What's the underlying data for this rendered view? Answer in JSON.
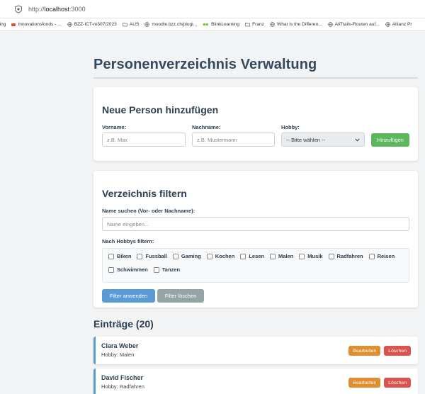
{
  "browser": {
    "url_prefix": "http://",
    "url_host": "localhost",
    "url_port": ":3000",
    "bookmarks": [
      {
        "label": "ning",
        "icon": "none-icon"
      },
      {
        "label": "Innovationsfonds - ...",
        "icon": "bookmark-icon"
      },
      {
        "label": "BZZ-ICT-m307/2023",
        "icon": "globe-icon"
      },
      {
        "label": "AUS",
        "icon": "folder-icon"
      },
      {
        "label": "moodle.bzz.ch/plugi...",
        "icon": "globe-icon"
      },
      {
        "label": "BlinkLearning",
        "icon": "dots-icon"
      },
      {
        "label": "Franz",
        "icon": "folder-icon"
      },
      {
        "label": "What Is the Differen...",
        "icon": "globe-icon"
      },
      {
        "label": "AllTrails-Routen auf...",
        "icon": "globe-icon"
      },
      {
        "label": "Allianz Pr",
        "icon": "globe-icon"
      }
    ]
  },
  "page": {
    "title": "Personenverzeichnis Verwaltung"
  },
  "add_form": {
    "title": "Neue Person hinzufügen",
    "firstname_label": "Vorname:",
    "firstname_placeholder": "z.B. Max",
    "lastname_label": "Nachname:",
    "lastname_placeholder": "z.B. Mustermann",
    "hobby_label": "Hobby:",
    "hobby_selected": "-- Bitte wählen --",
    "submit_label": "Hinzufügen"
  },
  "filter": {
    "title": "Verzeichnis filtern",
    "name_label": "Name suchen (Vor- oder Nachname):",
    "name_placeholder": "Name eingeben...",
    "hobby_label": "Nach Hobbys filtern:",
    "hobbies": [
      "Biken",
      "Fussball",
      "Gaming",
      "Kochen",
      "Lesen",
      "Malen",
      "Musik",
      "Radfahren",
      "Reisen",
      "Schwimmen",
      "Tanzen"
    ],
    "apply_label": "Filter anwenden",
    "clear_label": "Filter löschen"
  },
  "entries": {
    "title": "Einträge (20)",
    "edit_label": "Bearbeiten",
    "delete_label": "Löschen",
    "items": [
      {
        "name": "Clara Weber",
        "hobby": "Hobby: Malen"
      },
      {
        "name": "David Fischer",
        "hobby": "Hobby: Radfahren"
      }
    ]
  },
  "colors": {
    "accent_blue": "#5b9bd5",
    "add_green": "#5cb85c",
    "edit_orange": "#e08e2f",
    "delete_red": "#d9534f",
    "clear_gray": "#95a5a6"
  }
}
